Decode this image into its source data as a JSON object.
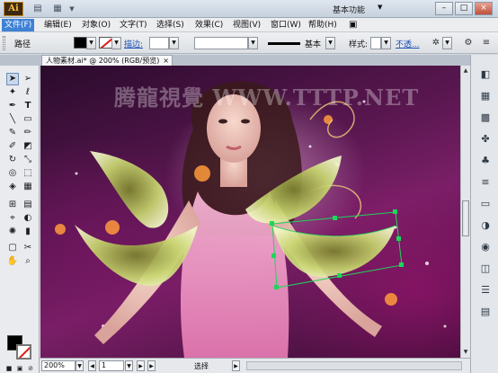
{
  "titlebar": {
    "app_logo": "Ai",
    "workspace": "基本功能",
    "buttons": [
      "–",
      "□",
      "×"
    ]
  },
  "menu": [
    "文件(F)",
    "编辑(E)",
    "对象(O)",
    "文字(T)",
    "选择(S)",
    "效果(C)",
    "视图(V)",
    "窗口(W)",
    "帮助(H)"
  ],
  "control": {
    "path_label": "路径",
    "stroke_link": "描边:",
    "basic_label": "基本",
    "style_label": "样式:",
    "opacity_link": "不透..."
  },
  "document": {
    "tab_title": "人物素材.ai* @ 200% (RGB/预览)",
    "close": "×",
    "watermark": "腾龍視覺 WWW.TTTP.NET"
  },
  "status": {
    "zoom": "200%",
    "page": "1",
    "tool": "选择"
  },
  "colors": {
    "accent": "#3e82d6",
    "selection": "#1fd65a",
    "fill": "#000000"
  }
}
